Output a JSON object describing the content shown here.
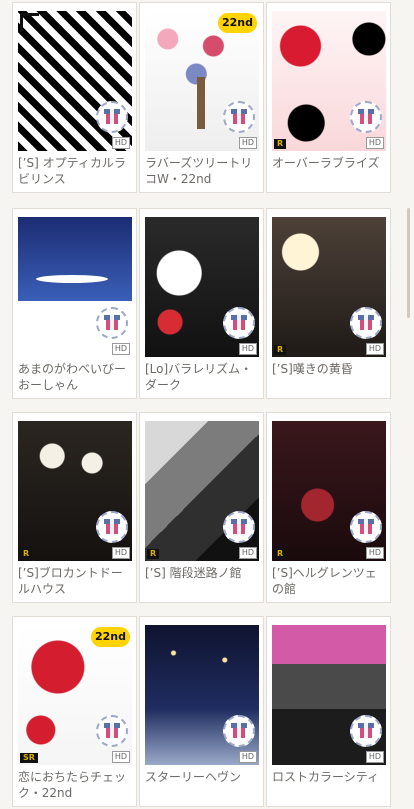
{
  "items": [
    {
      "title": "[’S] オプティカルラビリンス",
      "rank": "",
      "badge": ""
    },
    {
      "title": "ラバーズツリートリコW・22nd",
      "rank": "",
      "badge": "22nd"
    },
    {
      "title": "オーバーラブライズ",
      "rank": "R",
      "badge": ""
    },
    {
      "title": "あまのがわべいびーおーしゃん",
      "rank": "",
      "badge": ""
    },
    {
      "title": "[Lo]バラレリズム・ダーク",
      "rank": "",
      "badge": ""
    },
    {
      "title": "[’S]嘆きの黄昏",
      "rank": "R",
      "badge": ""
    },
    {
      "title": "[’S]ブロカントドールハウス",
      "rank": "R",
      "badge": ""
    },
    {
      "title": "[’S] 階段迷路ノ館",
      "rank": "R",
      "badge": ""
    },
    {
      "title": "[’S]ヘルグレンツェの館",
      "rank": "R",
      "badge": ""
    },
    {
      "title": "恋におちたらチェック・22nd",
      "rank": "SR",
      "badge": "22nd"
    },
    {
      "title": "スターリーヘヴン",
      "rank": "",
      "badge": ""
    },
    {
      "title": "ロストカラーシティ",
      "rank": "",
      "badge": ""
    }
  ],
  "labels": {
    "hd": "HD"
  }
}
